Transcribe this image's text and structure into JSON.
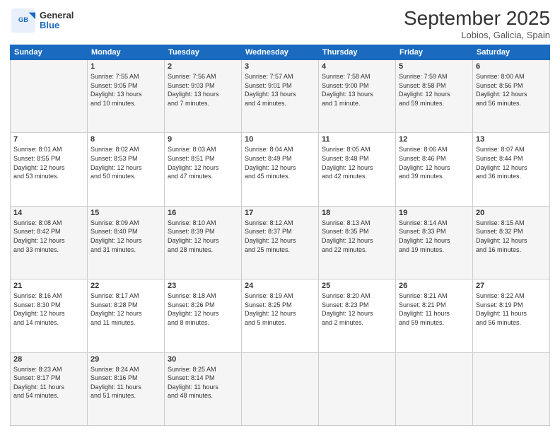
{
  "logo": {
    "general": "General",
    "blue": "Blue"
  },
  "header": {
    "month": "September 2025",
    "location": "Lobios, Galicia, Spain"
  },
  "weekdays": [
    "Sunday",
    "Monday",
    "Tuesday",
    "Wednesday",
    "Thursday",
    "Friday",
    "Saturday"
  ],
  "weeks": [
    [
      {
        "day": "",
        "info": ""
      },
      {
        "day": "1",
        "info": "Sunrise: 7:55 AM\nSunset: 9:05 PM\nDaylight: 13 hours\nand 10 minutes."
      },
      {
        "day": "2",
        "info": "Sunrise: 7:56 AM\nSunset: 9:03 PM\nDaylight: 13 hours\nand 7 minutes."
      },
      {
        "day": "3",
        "info": "Sunrise: 7:57 AM\nSunset: 9:01 PM\nDaylight: 13 hours\nand 4 minutes."
      },
      {
        "day": "4",
        "info": "Sunrise: 7:58 AM\nSunset: 9:00 PM\nDaylight: 13 hours\nand 1 minute."
      },
      {
        "day": "5",
        "info": "Sunrise: 7:59 AM\nSunset: 8:58 PM\nDaylight: 12 hours\nand 59 minutes."
      },
      {
        "day": "6",
        "info": "Sunrise: 8:00 AM\nSunset: 8:56 PM\nDaylight: 12 hours\nand 56 minutes."
      }
    ],
    [
      {
        "day": "7",
        "info": "Sunrise: 8:01 AM\nSunset: 8:55 PM\nDaylight: 12 hours\nand 53 minutes."
      },
      {
        "day": "8",
        "info": "Sunrise: 8:02 AM\nSunset: 8:53 PM\nDaylight: 12 hours\nand 50 minutes."
      },
      {
        "day": "9",
        "info": "Sunrise: 8:03 AM\nSunset: 8:51 PM\nDaylight: 12 hours\nand 47 minutes."
      },
      {
        "day": "10",
        "info": "Sunrise: 8:04 AM\nSunset: 8:49 PM\nDaylight: 12 hours\nand 45 minutes."
      },
      {
        "day": "11",
        "info": "Sunrise: 8:05 AM\nSunset: 8:48 PM\nDaylight: 12 hours\nand 42 minutes."
      },
      {
        "day": "12",
        "info": "Sunrise: 8:06 AM\nSunset: 8:46 PM\nDaylight: 12 hours\nand 39 minutes."
      },
      {
        "day": "13",
        "info": "Sunrise: 8:07 AM\nSunset: 8:44 PM\nDaylight: 12 hours\nand 36 minutes."
      }
    ],
    [
      {
        "day": "14",
        "info": "Sunrise: 8:08 AM\nSunset: 8:42 PM\nDaylight: 12 hours\nand 33 minutes."
      },
      {
        "day": "15",
        "info": "Sunrise: 8:09 AM\nSunset: 8:40 PM\nDaylight: 12 hours\nand 31 minutes."
      },
      {
        "day": "16",
        "info": "Sunrise: 8:10 AM\nSunset: 8:39 PM\nDaylight: 12 hours\nand 28 minutes."
      },
      {
        "day": "17",
        "info": "Sunrise: 8:12 AM\nSunset: 8:37 PM\nDaylight: 12 hours\nand 25 minutes."
      },
      {
        "day": "18",
        "info": "Sunrise: 8:13 AM\nSunset: 8:35 PM\nDaylight: 12 hours\nand 22 minutes."
      },
      {
        "day": "19",
        "info": "Sunrise: 8:14 AM\nSunset: 8:33 PM\nDaylight: 12 hours\nand 19 minutes."
      },
      {
        "day": "20",
        "info": "Sunrise: 8:15 AM\nSunset: 8:32 PM\nDaylight: 12 hours\nand 16 minutes."
      }
    ],
    [
      {
        "day": "21",
        "info": "Sunrise: 8:16 AM\nSunset: 8:30 PM\nDaylight: 12 hours\nand 14 minutes."
      },
      {
        "day": "22",
        "info": "Sunrise: 8:17 AM\nSunset: 8:28 PM\nDaylight: 12 hours\nand 11 minutes."
      },
      {
        "day": "23",
        "info": "Sunrise: 8:18 AM\nSunset: 8:26 PM\nDaylight: 12 hours\nand 8 minutes."
      },
      {
        "day": "24",
        "info": "Sunrise: 8:19 AM\nSunset: 8:25 PM\nDaylight: 12 hours\nand 5 minutes."
      },
      {
        "day": "25",
        "info": "Sunrise: 8:20 AM\nSunset: 8:23 PM\nDaylight: 12 hours\nand 2 minutes."
      },
      {
        "day": "26",
        "info": "Sunrise: 8:21 AM\nSunset: 8:21 PM\nDaylight: 11 hours\nand 59 minutes."
      },
      {
        "day": "27",
        "info": "Sunrise: 8:22 AM\nSunset: 8:19 PM\nDaylight: 11 hours\nand 56 minutes."
      }
    ],
    [
      {
        "day": "28",
        "info": "Sunrise: 8:23 AM\nSunset: 8:17 PM\nDaylight: 11 hours\nand 54 minutes."
      },
      {
        "day": "29",
        "info": "Sunrise: 8:24 AM\nSunset: 8:16 PM\nDaylight: 11 hours\nand 51 minutes."
      },
      {
        "day": "30",
        "info": "Sunrise: 8:25 AM\nSunset: 8:14 PM\nDaylight: 11 hours\nand 48 minutes."
      },
      {
        "day": "",
        "info": ""
      },
      {
        "day": "",
        "info": ""
      },
      {
        "day": "",
        "info": ""
      },
      {
        "day": "",
        "info": ""
      }
    ]
  ]
}
